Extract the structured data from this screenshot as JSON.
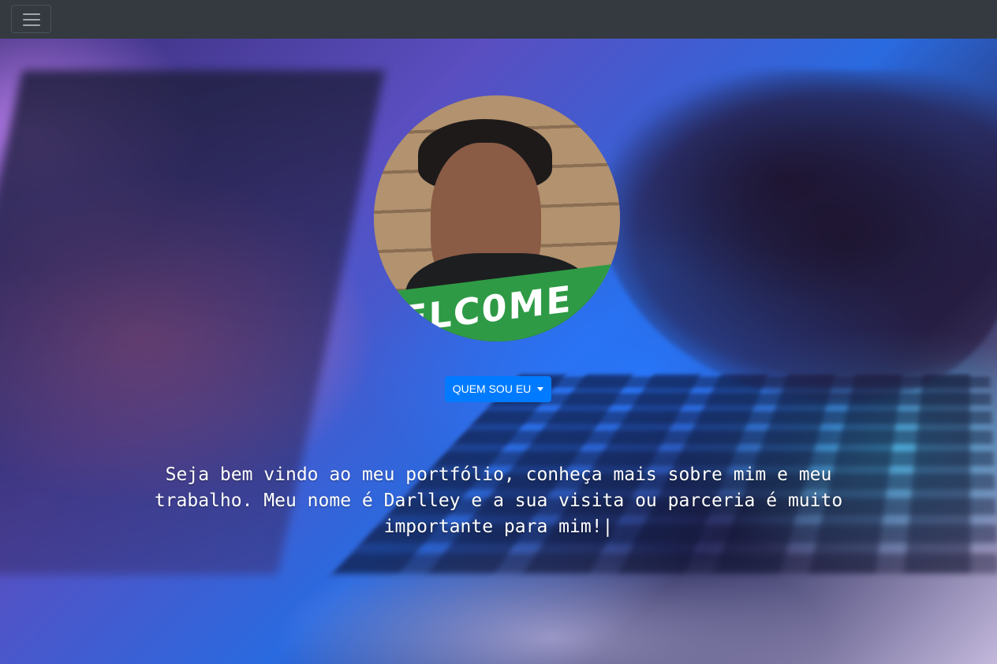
{
  "navbar": {
    "toggler_icon": "hamburger-menu-icon"
  },
  "hero": {
    "avatar_banner_text": "ELC0ME",
    "dropdown_label": "QUEM SOU EU",
    "welcome_text": "Seja bem vindo ao meu portfólio, conheça mais sobre mim e meu trabalho. Meu nome é Darlley e a sua visita ou parceria é muito importante para mim!|"
  },
  "colors": {
    "navbar_bg": "#343a40",
    "primary_button": "#007bff",
    "banner_green": "#2e9a45"
  }
}
